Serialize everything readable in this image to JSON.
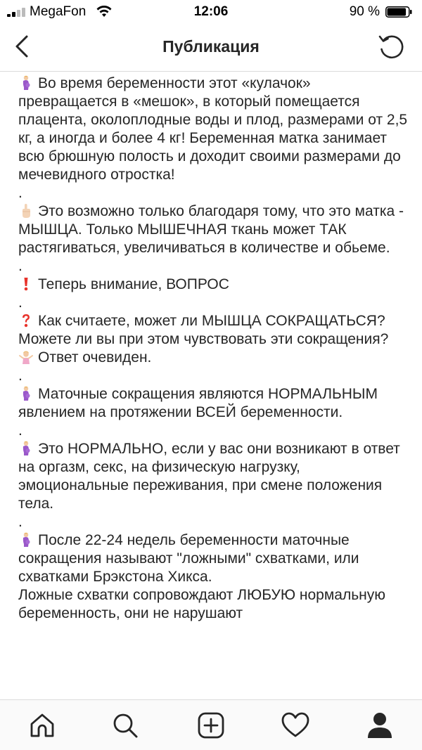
{
  "status_bar": {
    "carrier": "MegaFon",
    "time": "12:06",
    "battery_percent": "90 %",
    "battery_level": 0.9
  },
  "nav": {
    "title": "Публикация",
    "back_icon": "chevron-left-icon",
    "right_icon": "refresh-icon"
  },
  "post": {
    "blocks": [
      {
        "type": "para",
        "emoji": "pregnant-woman-icon",
        "text": "Во время беременности этот «кулачок» превращается в «мешок», в который помещается плацента, околоплодные воды и плод, размерами от 2,5 кг, а иногда и более 4 кг! Беременная матка занимает всю брюшную полость и доходит своими размерами до мечевидного отростка!"
      },
      {
        "type": "dot",
        "text": "."
      },
      {
        "type": "para",
        "emoji": "pointing-up-icon",
        "text": "Это возможно только благодаря тому, что это матка - МЫШЦА. Только МЫШЕЧНАЯ ткань может ТАК растягиваться, увеличиваться в количестве и обьеме."
      },
      {
        "type": "dot",
        "text": "."
      },
      {
        "type": "para",
        "emoji": "exclamation-icon",
        "text": "Теперь внимание, ВОПРОС"
      },
      {
        "type": "dot",
        "text": "."
      },
      {
        "type": "para",
        "emoji": "question-icon",
        "text": "Как считаете, может ли МЫШЦА СОКРАЩАТЬСЯ? Можете ли вы при этом чувствовать эти сокращения?"
      },
      {
        "type": "para",
        "emoji": "shrug-woman-icon",
        "text": "Ответ очевиден."
      },
      {
        "type": "dot",
        "text": "."
      },
      {
        "type": "para",
        "emoji": "pregnant-woman-icon",
        "text": "Маточные сокращения являются НОРМАЛЬНЫМ явлением на протяжении ВСЕЙ беременности."
      },
      {
        "type": "dot",
        "text": "."
      },
      {
        "type": "para",
        "emoji": "pregnant-woman-icon",
        "text": "Это НОРМАЛЬНО, если у вас они возникают в ответ на оргазм, секс, на физическую нагрузку, эмоциональные переживания, при смене положения тела."
      },
      {
        "type": "dot",
        "text": "."
      },
      {
        "type": "para",
        "emoji": "pregnant-woman-icon",
        "text": "После 22-24 недель беременности маточные сокращения называют \"ложными\" схватками, или схватками Брэкстона Хикса."
      },
      {
        "type": "para",
        "emoji": "",
        "text": "Ложные схватки сопровождают ЛЮБУЮ нормальную беременность, они не нарушают"
      }
    ]
  },
  "tab_bar": {
    "items": [
      "home-icon",
      "search-icon",
      "new-post-icon",
      "activity-heart-icon",
      "profile-icon"
    ]
  },
  "colors": {
    "text": "#262626",
    "divider": "#dbdbdb",
    "tabbar_bg": "#fafafa",
    "exclamation": "#e8322b"
  }
}
